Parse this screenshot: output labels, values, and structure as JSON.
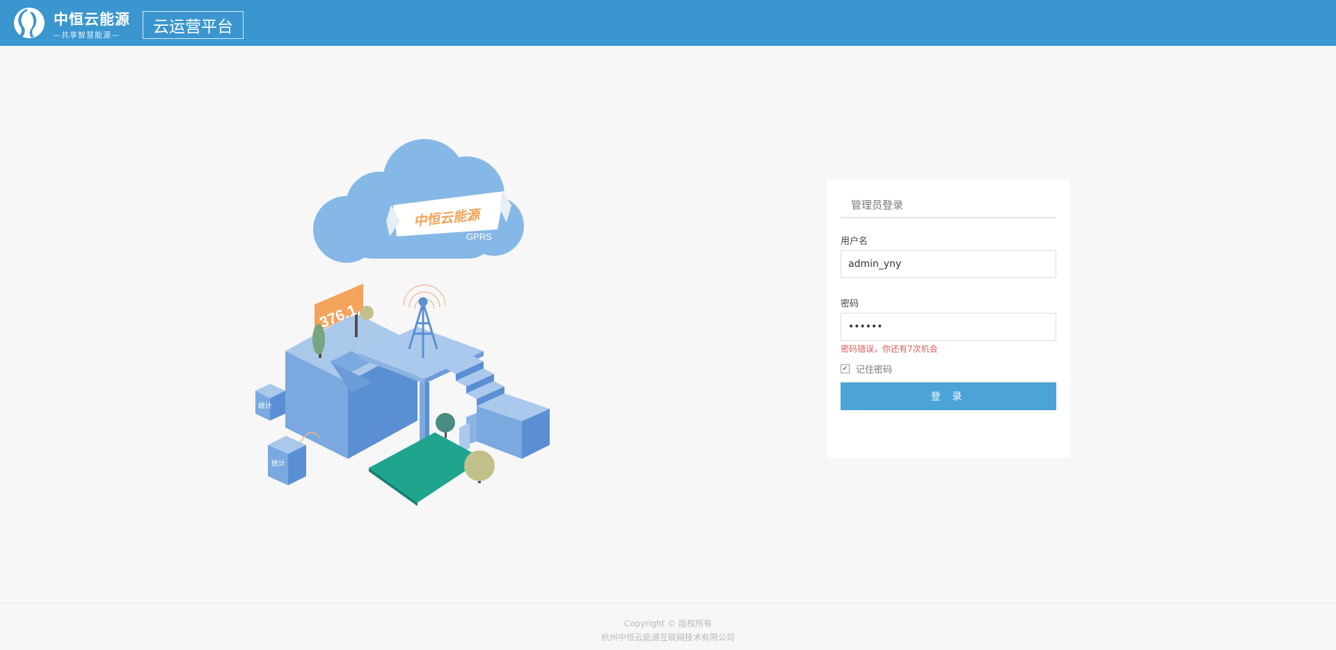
{
  "header": {
    "brand_name": "中恒云能源",
    "brand_slogan": "—共享智慧能源—",
    "platform_title": "云运营平台"
  },
  "illustration": {
    "banner_text": "中恒云能源",
    "gprs_text": "GPRS",
    "billboard_text": "376.1",
    "box_label_1": "统计",
    "box_label_2": "统计"
  },
  "login": {
    "title": "管理员登录",
    "username_label": "用户名",
    "username_value": "admin_yny",
    "password_label": "密码",
    "password_value": "••••••",
    "error_message": "密码错误，你还有7次机会",
    "remember_label": "记住密码",
    "remember_checked": true,
    "submit_label": "登 录"
  },
  "footer": {
    "copyright": "Copyright © 版权所有",
    "company": "杭州中恒云能源互联网技术有限公司"
  },
  "colors": {
    "header_bg": "#3b96cf",
    "button_bg": "#4ba3d8",
    "error": "#e05a5a",
    "page_bg": "#f7f7f7"
  }
}
